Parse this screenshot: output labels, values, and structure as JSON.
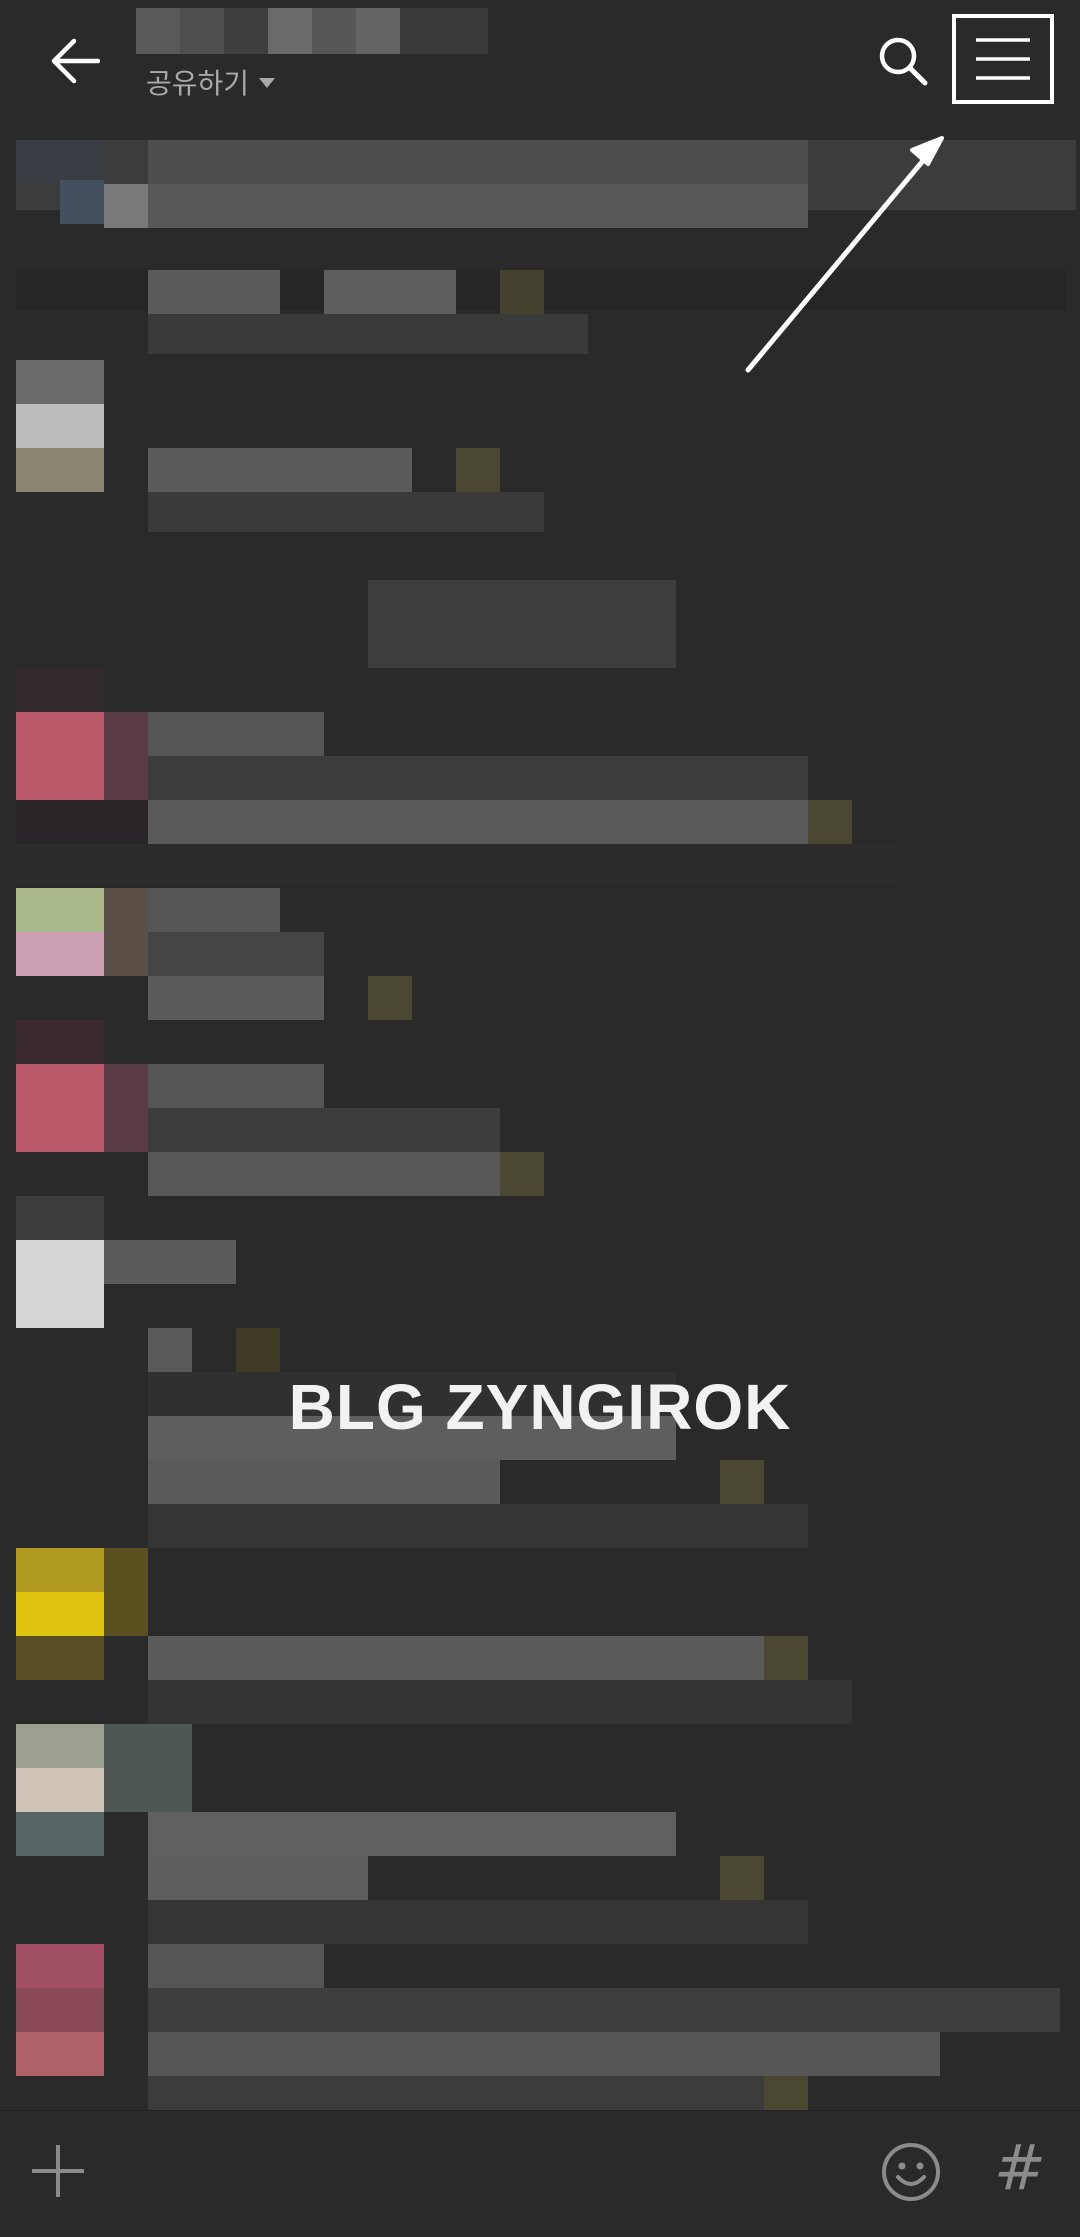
{
  "header": {
    "share_label": "공유하기",
    "back_icon": "back-arrow-icon",
    "search_icon": "search-icon",
    "menu_icon": "hamburger-menu-icon"
  },
  "overlay": {
    "caption": "BLG ZYNGIROK"
  },
  "footer": {
    "plus_icon": "plus-icon",
    "emoji_icon": "emoji-icon",
    "hash_label": "#"
  },
  "colors": {
    "background": "#2a2a2a",
    "highlight_border": "#ffffff",
    "arrow": "#ffffff"
  }
}
